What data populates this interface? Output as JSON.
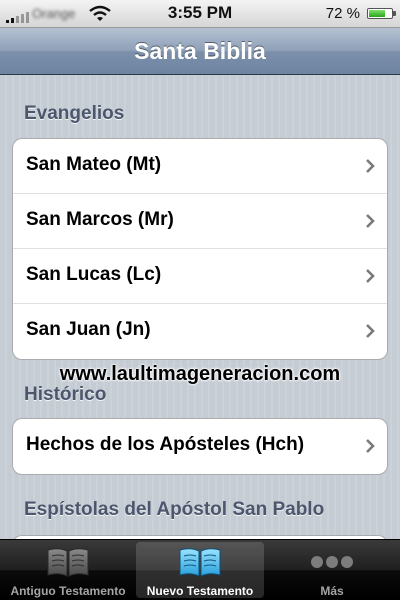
{
  "status_bar": {
    "carrier": "Orange",
    "time": "3:55 PM",
    "battery_text": "72 %",
    "battery_level": 0.72
  },
  "nav": {
    "title": "Santa Biblia"
  },
  "sections": [
    {
      "header": "Evangelios",
      "items": [
        "San Mateo (Mt)",
        "San Marcos (Mr)",
        "San Lucas (Lc)",
        "San Juan (Jn)"
      ]
    },
    {
      "header": "Histórico",
      "items": [
        "Hechos de los Apósteles (Hch)"
      ]
    },
    {
      "header": "Espístolas del Apóstol San Pablo",
      "items": []
    }
  ],
  "watermark": "www.laultimageneracion.com",
  "tabs": [
    {
      "label": "Antiguo Testamento",
      "icon": "closed-book-icon",
      "selected": false
    },
    {
      "label": "Nuevo Testamento",
      "icon": "open-book-icon",
      "selected": true
    },
    {
      "label": "Más",
      "icon": "more-dots-icon",
      "selected": false
    }
  ],
  "colors": {
    "nav_bar": "#6d84a2",
    "section_header": "#4c566c",
    "tab_selected_icon": "#5ec8f5"
  }
}
